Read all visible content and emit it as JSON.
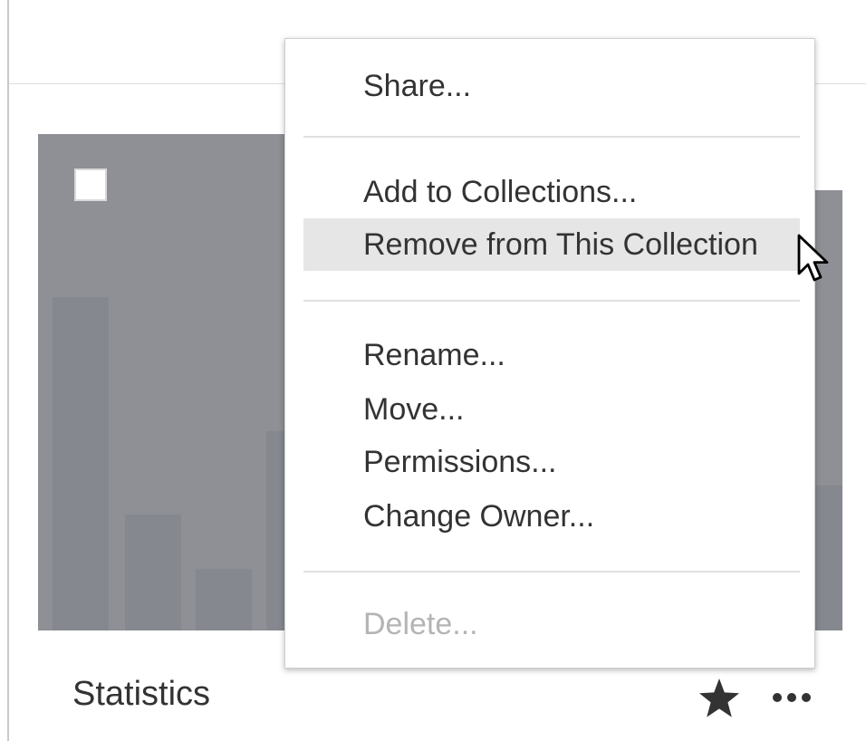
{
  "card": {
    "title": "Statistics",
    "favorite_icon": "star-icon",
    "more_actions_icon": "more-horizontal-icon",
    "thumbnail_color": "#8e9096"
  },
  "context_menu": {
    "share": "Share...",
    "add_to_collections": "Add to Collections...",
    "remove_from_collection": "Remove from This Collection",
    "rename": "Rename...",
    "move": "Move...",
    "permissions": "Permissions...",
    "change_owner": "Change Owner...",
    "delete": "Delete...",
    "hovered_item": "Remove from This Collection",
    "disabled_items": [
      "Delete..."
    ]
  },
  "colors": {
    "hover_background": "#e6e6e6",
    "text": "#333333",
    "disabled_text": "#b4b4b4"
  }
}
